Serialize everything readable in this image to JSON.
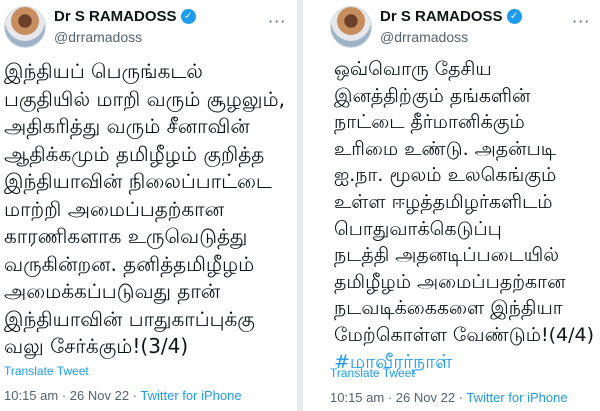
{
  "tweets": [
    {
      "author_name": "Dr S RAMADOSS",
      "verified_icon": "✓",
      "handle": "@drramadoss",
      "more_icon": "···",
      "lines": [
        "இந்தியப் பெருங்கடல்",
        "பகுதியில் மாறி வரும் சூழலும்,",
        "அதிகரித்து வரும் சீனாவின்",
        "ஆதிக்கமும் தமிழீழம் குறித்த",
        "இந்தியாவின் நிலைப்பாட்டை",
        "மாற்றி அமைப்பதற்கான",
        "காரணிகளாக உருவெடுத்து",
        "வருகின்றன. தனித்தமிழீழம்",
        "அமைக்கப்படுவது தான்",
        "இந்தியாவின் பாதுகாப்புக்கு",
        "வலு சேர்க்கும்!(3/4)"
      ],
      "hashtag": "",
      "translate_label": "Translate Tweet",
      "time": "10:15 am",
      "date": "26 Nov 22",
      "source": "Twitter for iPhone"
    },
    {
      "author_name": "Dr S RAMADOSS",
      "verified_icon": "✓",
      "handle": "@drramadoss",
      "more_icon": "···",
      "lines": [
        "ஒவ்வொரு தேசிய",
        "இனத்திற்கும் தங்களின்",
        "நாட்டை தீர்மானிக்கும்",
        "உரிமை உண்டு. அதன்படி",
        "ஐ.நா. மூலம் உலகெங்கும்",
        "உள்ள ஈழத்தமிழர்களிடம்",
        "பொதுவாக்கெடுப்பு",
        "நடத்தி அதனடிப்படையில்",
        "தமிழீழம் அமைப்பதற்கான",
        "நடவடிக்கைகளை இந்தியா",
        "மேற்கொள்ள வேண்டும்!(4/4)"
      ],
      "hashtag": "#மாவீரர்நாள்",
      "translate_label": "Translate Tweet",
      "time": "10:15 am",
      "date": "26 Nov 22",
      "source": "Twitter for iPhone"
    }
  ]
}
